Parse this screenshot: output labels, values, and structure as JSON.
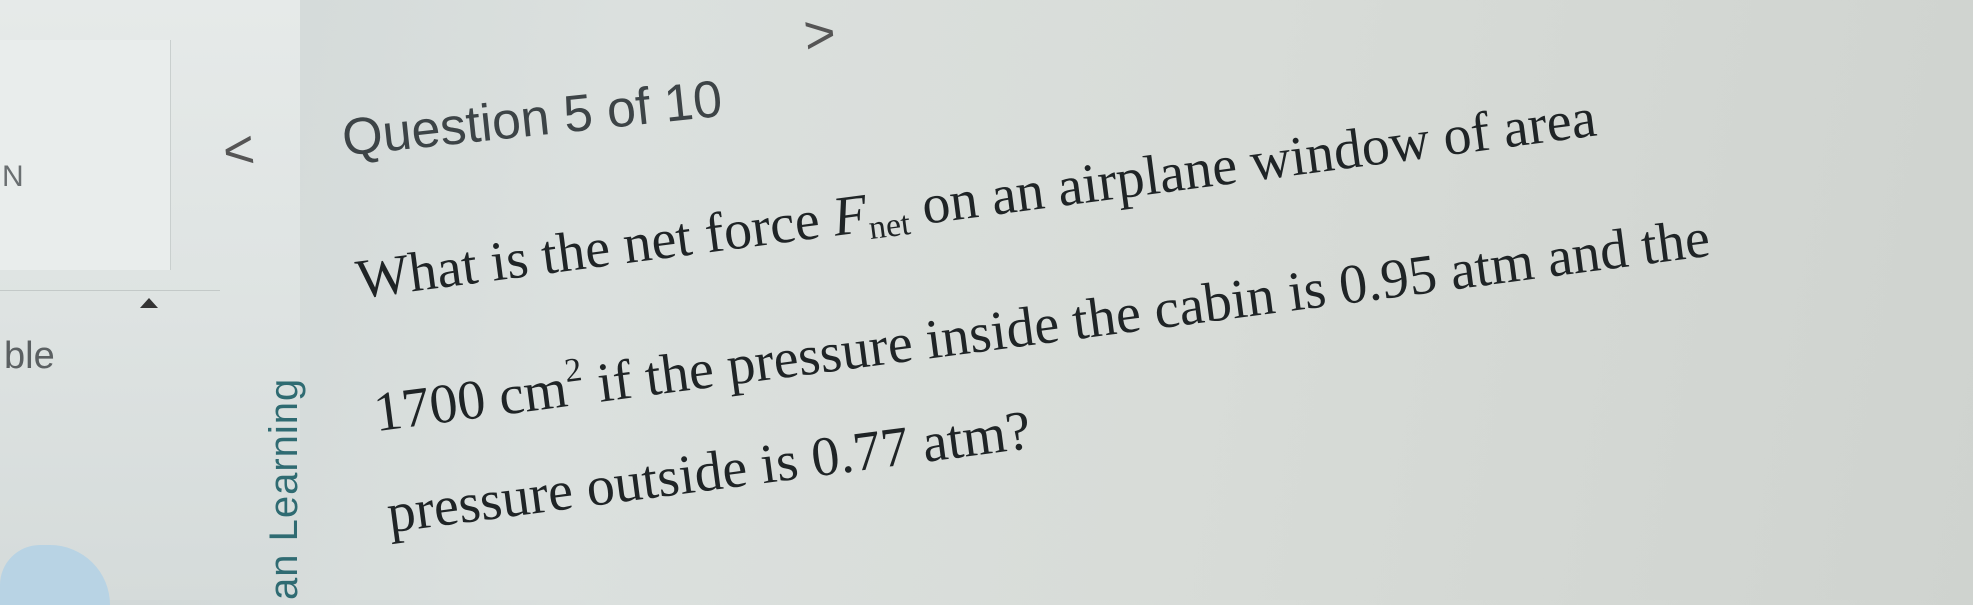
{
  "sidebar": {
    "glyph": "N",
    "label": "ble"
  },
  "vertical_label": "an Learning",
  "nav": {
    "prev_symbol": "<",
    "title": "Question 5 of 10",
    "next_symbol": ">"
  },
  "question": {
    "line1_a": "What is the net force ",
    "force_symbol": "F",
    "force_sub": "net",
    "line1_b": " on an airplane window of area",
    "line2_a": "1700 cm",
    "line2_sup": "2",
    "line2_b": " if the pressure inside the cabin is 0.95 atm and the",
    "line3": "pressure outside is 0.77 atm?"
  }
}
